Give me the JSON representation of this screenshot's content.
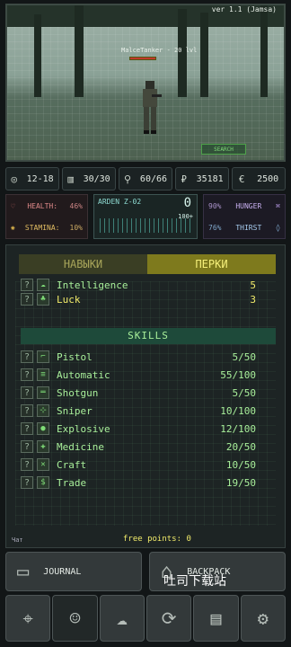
{
  "scene": {
    "version": "ver 1.1 (Jamsa)",
    "enemy_label": "MalceTanker - 20 lvl",
    "search_button": "SEARCH"
  },
  "stats": [
    {
      "icon": "target-icon",
      "glyph": "◎",
      "value": "12-18"
    },
    {
      "icon": "ammo-icon",
      "glyph": "▥",
      "value": "30/30"
    },
    {
      "icon": "weight-icon",
      "glyph": "⚲",
      "value": "60/66"
    },
    {
      "icon": "rouble-icon",
      "glyph": "₽",
      "value": "35181"
    },
    {
      "icon": "euro-icon",
      "glyph": "€",
      "value": "2500"
    }
  ],
  "vitals": {
    "health": {
      "label": "HEALTH:",
      "value": "46%"
    },
    "stamina": {
      "label": "STAMINA:",
      "value": "10%"
    },
    "hunger": {
      "label": "HUNGER",
      "value": "90%"
    },
    "thirst": {
      "label": "THIRST",
      "value": "76%"
    },
    "radio": {
      "label": "ARDEN Z-02",
      "value": "0",
      "max": "100+"
    }
  },
  "tabs": {
    "skills": "НАВЫКИ",
    "perks": "ПЕРКИ"
  },
  "attributes": [
    {
      "name": "Intelligence",
      "value": "5"
    },
    {
      "name": "Luck",
      "value": "3"
    }
  ],
  "skills_header": "SKILLS",
  "skills": [
    {
      "name": "Pistol",
      "value": "5/50"
    },
    {
      "name": "Automatic",
      "value": "55/100"
    },
    {
      "name": "Shotgun",
      "value": "5/50"
    },
    {
      "name": "Sniper",
      "value": "10/100"
    },
    {
      "name": "Explosive",
      "value": "12/100"
    },
    {
      "name": "Medicine",
      "value": "20/50"
    },
    {
      "name": "Craft",
      "value": "10/50"
    },
    {
      "name": "Trade",
      "value": "19/50"
    }
  ],
  "chat_label": "Чат",
  "free_points": "free points: 0",
  "buttons": {
    "journal": "JOURNAL",
    "backpack": "BACKPACK"
  },
  "watermark": "吐司下载站",
  "nav": [
    "map-icon",
    "character-icon",
    "brain-icon",
    "exchange-icon",
    "radio-icon",
    "settings-icon"
  ]
}
